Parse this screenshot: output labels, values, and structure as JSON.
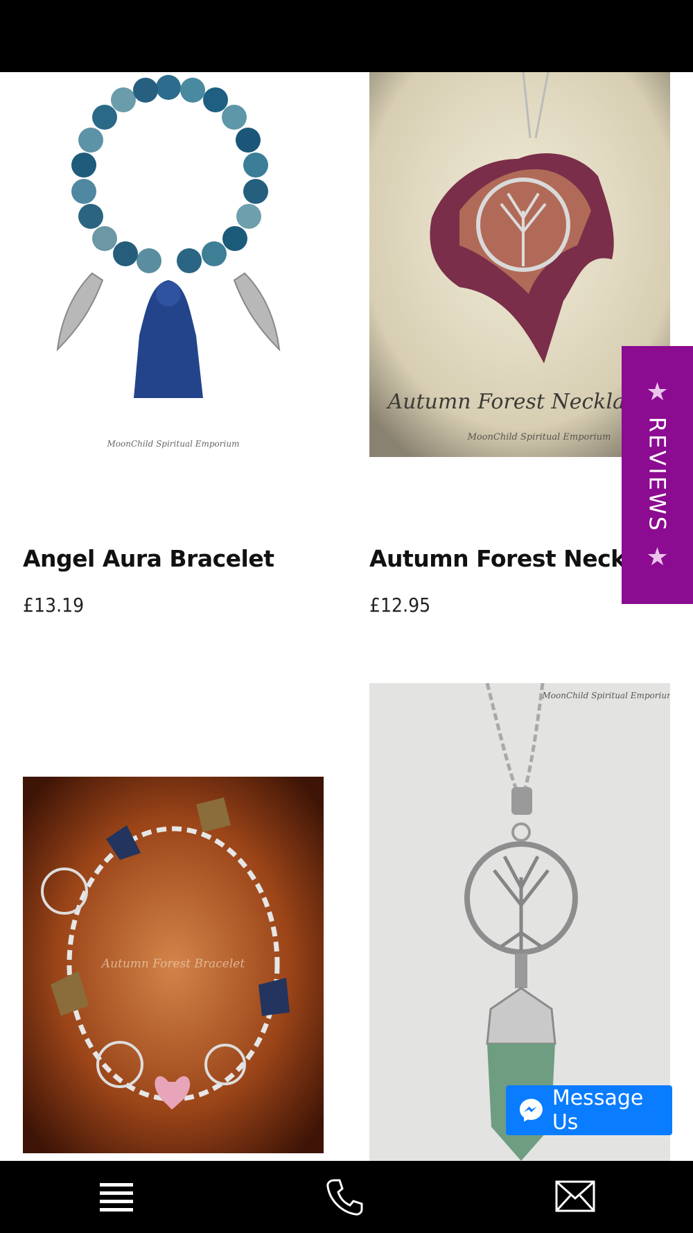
{
  "products": [
    {
      "title": "Angel Aura Bracelet",
      "price": "£13.19",
      "image_caption": "MoonChild Spiritual Emporium"
    },
    {
      "title": "Autumn Forest Necklace",
      "price": "£12.95",
      "image_caption": "Autumn Forest Necklace",
      "image_sub": "MoonChild Spiritual Emporium"
    },
    {
      "title": "",
      "price": "",
      "image_caption": "Autumn Forest Bracelet"
    },
    {
      "title": "",
      "price": "",
      "image_caption": "MoonChild Spiritual Emporium"
    }
  ],
  "reviews_tab": {
    "label": "REVIEWS"
  },
  "message_button": {
    "label": "Message Us"
  },
  "bottom_nav": [
    {
      "icon": "menu-icon"
    },
    {
      "icon": "phone-icon"
    },
    {
      "icon": "mail-icon"
    }
  ],
  "colors": {
    "reviews": "#8b0b91",
    "messenger": "#0a7cff",
    "bars": "#000000"
  }
}
